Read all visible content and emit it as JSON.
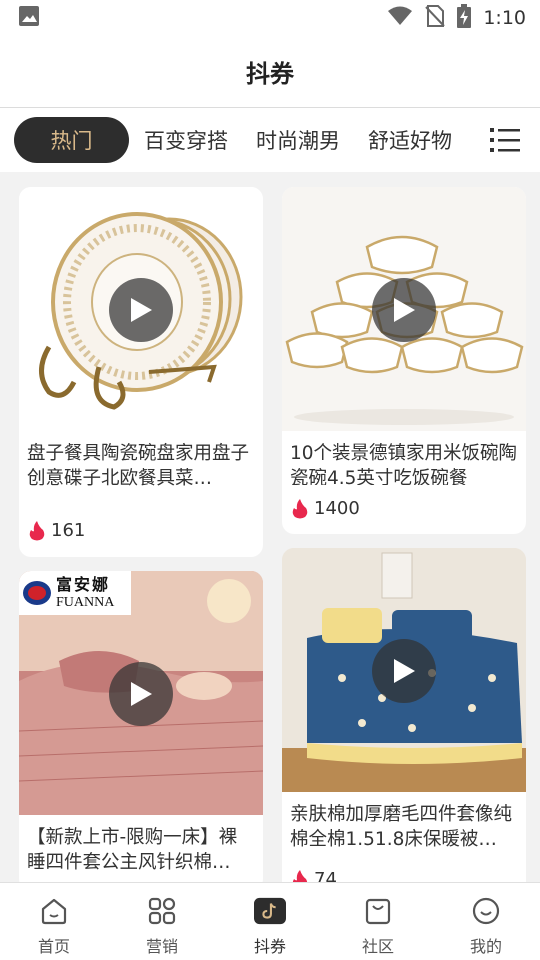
{
  "status_bar": {
    "time": "1:10",
    "icons": [
      "image-icon",
      "wifi-icon",
      "no-sim-icon",
      "battery-charging-icon"
    ]
  },
  "header": {
    "title": "抖券"
  },
  "tabs": [
    {
      "label": "热门",
      "active": true
    },
    {
      "label": "百变穿搭"
    },
    {
      "label": "时尚潮男"
    },
    {
      "label": "舒适好物"
    }
  ],
  "menu_icon": "list-menu-icon",
  "cards": [
    {
      "title": "盘子餐具陶瓷碗盘家用盘子创意碟子北欧餐具菜…",
      "count": "161"
    },
    {
      "title": "10个装景德镇家用米饭碗陶瓷碗4.5英寸吃饭碗餐",
      "count": "1400"
    },
    {
      "title": "【新款上市-限购一床】裸睡四件套公主风针织棉…",
      "count": "",
      "brand_cn": "富安娜",
      "brand_en": "FUANNA"
    },
    {
      "title": "亲肤棉加厚磨毛四件套像纯棉全棉1.51.8床保暖被…",
      "count": "74"
    }
  ],
  "bottom_nav": [
    {
      "label": "首页",
      "icon": "home-icon"
    },
    {
      "label": "营销",
      "icon": "apps-grid-icon"
    },
    {
      "label": "抖券",
      "icon": "tiktok-icon",
      "active": true
    },
    {
      "label": "社区",
      "icon": "bag-icon"
    },
    {
      "label": "我的",
      "icon": "smiley-icon"
    }
  ],
  "colors": {
    "accent": "#d9b98a",
    "active_tab_bg": "#2d2d2d",
    "flame": "#e8284d"
  }
}
